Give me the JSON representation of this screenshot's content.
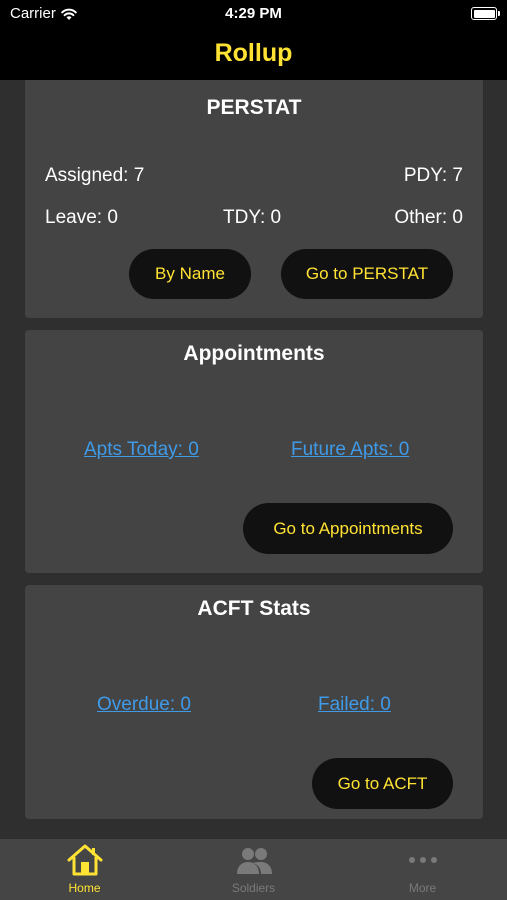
{
  "status_bar": {
    "carrier": "Carrier",
    "time": "4:29 PM"
  },
  "nav": {
    "title": "Rollup"
  },
  "perstat": {
    "title": "PERSTAT",
    "assigned": "Assigned: 7",
    "pdy": "PDY: 7",
    "leave": "Leave: 0",
    "tdy": "TDY: 0",
    "other": "Other: 0",
    "by_name_label": "By Name",
    "go_label": "Go to PERSTAT"
  },
  "appointments": {
    "title": "Appointments",
    "today_link": "Apts Today: 0",
    "future_link": "Future Apts: 0",
    "go_label": "Go to Appointments"
  },
  "acft": {
    "title": "ACFT Stats",
    "overdue_link": "Overdue: 0",
    "failed_link": "Failed: 0",
    "go_label": "Go to ACFT"
  },
  "tab_bar": {
    "tabs": [
      {
        "label": "Home",
        "icon": "home-icon",
        "active": true
      },
      {
        "label": "Soldiers",
        "icon": "soldiers-icon",
        "active": false
      },
      {
        "label": "More",
        "icon": "more-icon",
        "active": false
      }
    ]
  },
  "colors": {
    "accent": "#ffe233",
    "link": "#3f9ae8",
    "background": "#2f2f2f",
    "card": "#444444",
    "inactive_tab": "#7a7a7a"
  }
}
